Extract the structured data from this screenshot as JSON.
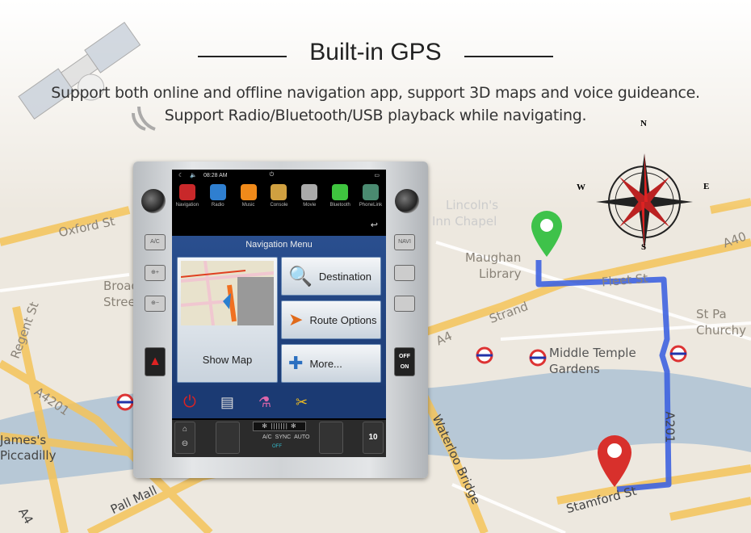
{
  "header": {
    "title": "Built-in GPS",
    "subtitle_line1": "Support both online and offline navigation app, support 3D maps and voice guideance.",
    "subtitle_line2": "Support Radio/Bluetooth/USB playback while navigating."
  },
  "compass": {
    "n": "N",
    "s": "S",
    "e": "E",
    "w": "W"
  },
  "map_labels": [
    "Oxford St",
    "Broad",
    "Street",
    "Regent St",
    "A4201",
    "James's",
    "Piccadilly",
    "Pall Mall",
    "A4",
    "Waterloo Bridge",
    "Strand",
    "A4",
    "Maughan",
    "Library",
    "Fleet St",
    "Middle Temple",
    "Gardens",
    "St Pa",
    "Churchy",
    "A201",
    "Stamford St",
    "A40",
    "Lincoln's",
    "Inn Chapel"
  ],
  "route_color": "#3e63e0",
  "pins": {
    "start_color": "#3ec24a",
    "end_color": "#d8302c"
  },
  "device": {
    "left_buttons": [
      "A/C",
      "⊕+",
      "⊕−"
    ],
    "right_buttons": [
      "NAVI",
      "",
      "",
      "OFF",
      "ON"
    ],
    "status": {
      "time": "08:28 AM"
    },
    "apps": [
      {
        "label": "Navigation",
        "color": "#c8282a"
      },
      {
        "label": "Radio",
        "color": "#2f7fd0"
      },
      {
        "label": "Music",
        "color": "#f08a1a"
      },
      {
        "label": "Console",
        "color": "#d0a040"
      },
      {
        "label": "Movie",
        "color": "#aaaaaa"
      },
      {
        "label": "Bluetooth",
        "color": "#3fc43f"
      },
      {
        "label": "PhoneLink",
        "color": "#4a8a70"
      }
    ],
    "nav_menu": {
      "title": "Navigation Menu",
      "show_map": "Show Map",
      "destination": "Destination",
      "route_options": "Route Options",
      "more": "More..."
    },
    "climate": {
      "ac": "A/C",
      "sync": "SYNC",
      "auto": "AUTO",
      "off": "OFF",
      "temp": "10"
    }
  }
}
